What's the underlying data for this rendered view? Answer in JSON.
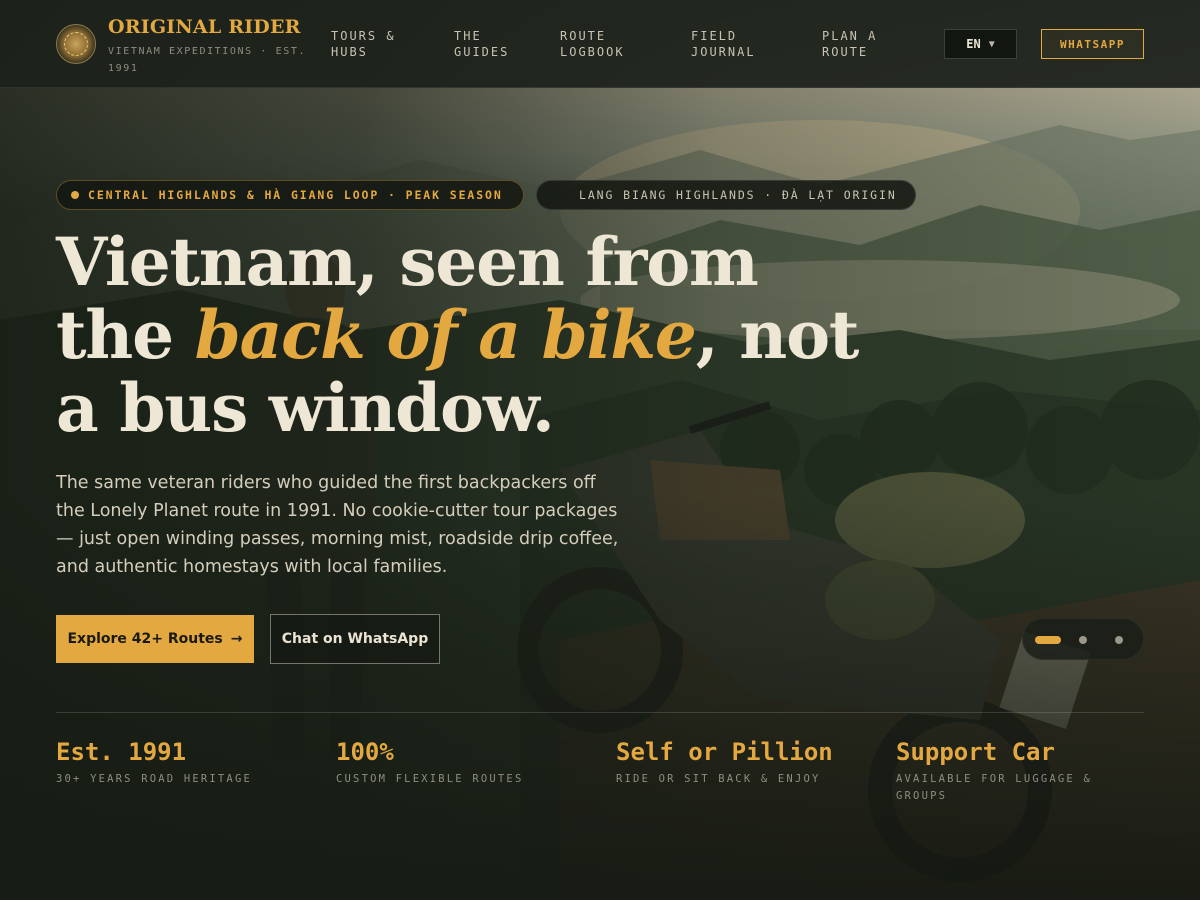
{
  "brand": {
    "name": "ORIGINAL RIDER",
    "tagline": "VIETNAM EXPEDITIONS · EST. 1991"
  },
  "nav": {
    "items": [
      {
        "label": "TOURS & HUBS"
      },
      {
        "label": "THE GUIDES"
      },
      {
        "label": "ROUTE LOGBOOK"
      },
      {
        "label": "FIELD JOURNAL"
      },
      {
        "label": "PLAN A ROUTE"
      }
    ],
    "language": "EN",
    "whatsapp": "WHATSAPP"
  },
  "hero": {
    "pill_primary": "CENTRAL HIGHLANDS & HÀ GIANG LOOP · PEAK SEASON",
    "pill_secondary": "LANG BIANG HIGHLANDS · ĐÀ LẠT ORIGIN",
    "headline_part1": "Vietnam, seen from the ",
    "headline_accent": "back of a bike",
    "headline_part2": ", not a bus window.",
    "lead": "The same veteran riders who guided the first backpackers off the Lonely Planet route in 1991. No cookie-cutter tour packages — just open winding passes, morning mist, roadside drip coffee, and authentic homestays with local families.",
    "cta_primary": "Explore 42+ Routes",
    "cta_primary_icon": "→",
    "cta_secondary": "Chat on WhatsApp"
  },
  "slider": {
    "count": 3,
    "active_index": 1
  },
  "stats": [
    {
      "value": "Est. 1991",
      "label": "30+ YEARS ROAD HERITAGE"
    },
    {
      "value": "100%",
      "label": "CUSTOM FLEXIBLE ROUTES"
    },
    {
      "value": "Self or Pillion",
      "label": "RIDE OR SIT BACK & ENJOY"
    },
    {
      "value": "Support Car",
      "label": "AVAILABLE FOR LUGGAGE & GROUPS"
    }
  ],
  "colors": {
    "accent": "#e3a83f",
    "background": "#1e231d",
    "text": "#efe7d6"
  }
}
